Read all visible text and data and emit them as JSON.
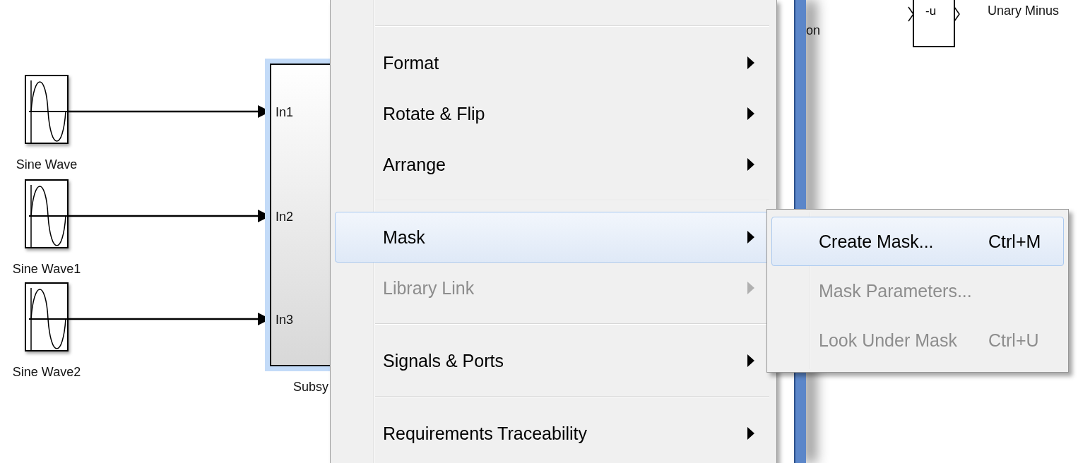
{
  "canvas": {
    "sources": [
      {
        "label": "Sine Wave",
        "port": "In1"
      },
      {
        "label": "Sine Wave1",
        "port": "In2"
      },
      {
        "label": "Sine Wave2",
        "port": "In3"
      }
    ],
    "subsystem": {
      "label": "Subsy",
      "selected": true
    },
    "background_window": {
      "text": "on"
    },
    "unary_minus": {
      "symbol": "-u",
      "label": "Unary Minus"
    }
  },
  "context_menu": {
    "items": [
      {
        "kind": "separator"
      },
      {
        "kind": "item",
        "label": "Format",
        "submenu": true,
        "disabled": false,
        "selected": false
      },
      {
        "kind": "item",
        "label": "Rotate & Flip",
        "submenu": true,
        "disabled": false,
        "selected": false
      },
      {
        "kind": "item",
        "label": "Arrange",
        "submenu": true,
        "disabled": false,
        "selected": false
      },
      {
        "kind": "separator"
      },
      {
        "kind": "item",
        "label": "Mask",
        "submenu": true,
        "disabled": false,
        "selected": true
      },
      {
        "kind": "item",
        "label": "Library Link",
        "submenu": true,
        "disabled": true,
        "selected": false
      },
      {
        "kind": "separator"
      },
      {
        "kind": "item",
        "label": "Signals & Ports",
        "submenu": true,
        "disabled": false,
        "selected": false
      },
      {
        "kind": "separator"
      },
      {
        "kind": "item",
        "label": "Requirements Traceability",
        "submenu": true,
        "disabled": false,
        "selected": false
      }
    ]
  },
  "submenu": {
    "items": [
      {
        "label": "Create Mask...",
        "shortcut": "Ctrl+M",
        "disabled": false,
        "selected": true
      },
      {
        "label": "Mask Parameters...",
        "disabled": true,
        "selected": false
      },
      {
        "label": "Look Under Mask",
        "shortcut": "Ctrl+U",
        "disabled": true,
        "selected": false
      }
    ]
  }
}
